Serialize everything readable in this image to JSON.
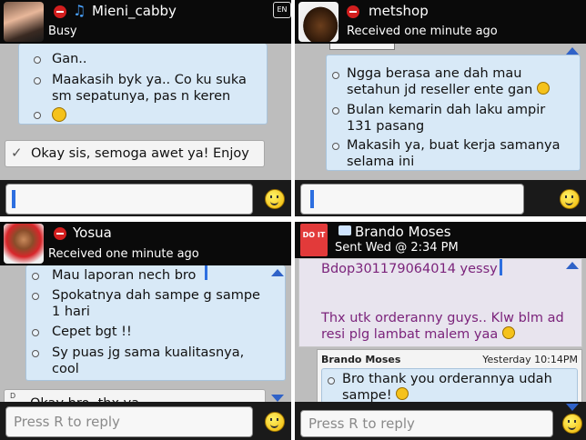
{
  "panels": [
    {
      "contact_name": "Mieni_cabby",
      "status": "Busy",
      "en_badge": "EN",
      "messages": [
        "Gan..",
        "Maakasih byk ya.. Co ku suka",
        "sm sepatunya, pas n keren",
        "Okay sis, semoga awet ya! Enjoy"
      ]
    },
    {
      "contact_name": "metshop",
      "status": "Received one minute ago",
      "messages": [
        "Ngga berasa ane dah mau",
        "setahun jd reseller ente gan",
        "Bulan kemarin dah laku ampir",
        "131 pasang",
        "Makasih ya, buat kerja samanya",
        "selama ini"
      ]
    },
    {
      "contact_name": "Yosua",
      "status": "Received one minute ago",
      "messages": [
        "Mau laporan nech bro",
        "Spokatnya dah sampe g sampe",
        "1 hari",
        "Cepet bgt !!",
        "Sy puas jg sama kualitasnya,",
        "cool",
        "Okay bro, thx ya"
      ],
      "input_placeholder": "Press R to reply"
    },
    {
      "contact_name": "Brando Moses",
      "status": "Sent Wed @ 2:34 PM",
      "avatar_text": "DO IT",
      "messages": [
        "Bdop301179064014 yessy",
        "Thx utk orderanny guys.. Klw blm ad",
        "resi plg lambat malem yaa"
      ],
      "reply": {
        "sender": "Brando Moses",
        "time": "Yesterday 10:14PM",
        "text_line1": "Bro thank you orderannya udah",
        "text_line2": "sampe!"
      },
      "input_placeholder": "Press R to reply"
    }
  ],
  "colors": {
    "accent": "#2d6fe0",
    "bubble": "#d8e9f7",
    "purple_text": "#7b237b"
  }
}
